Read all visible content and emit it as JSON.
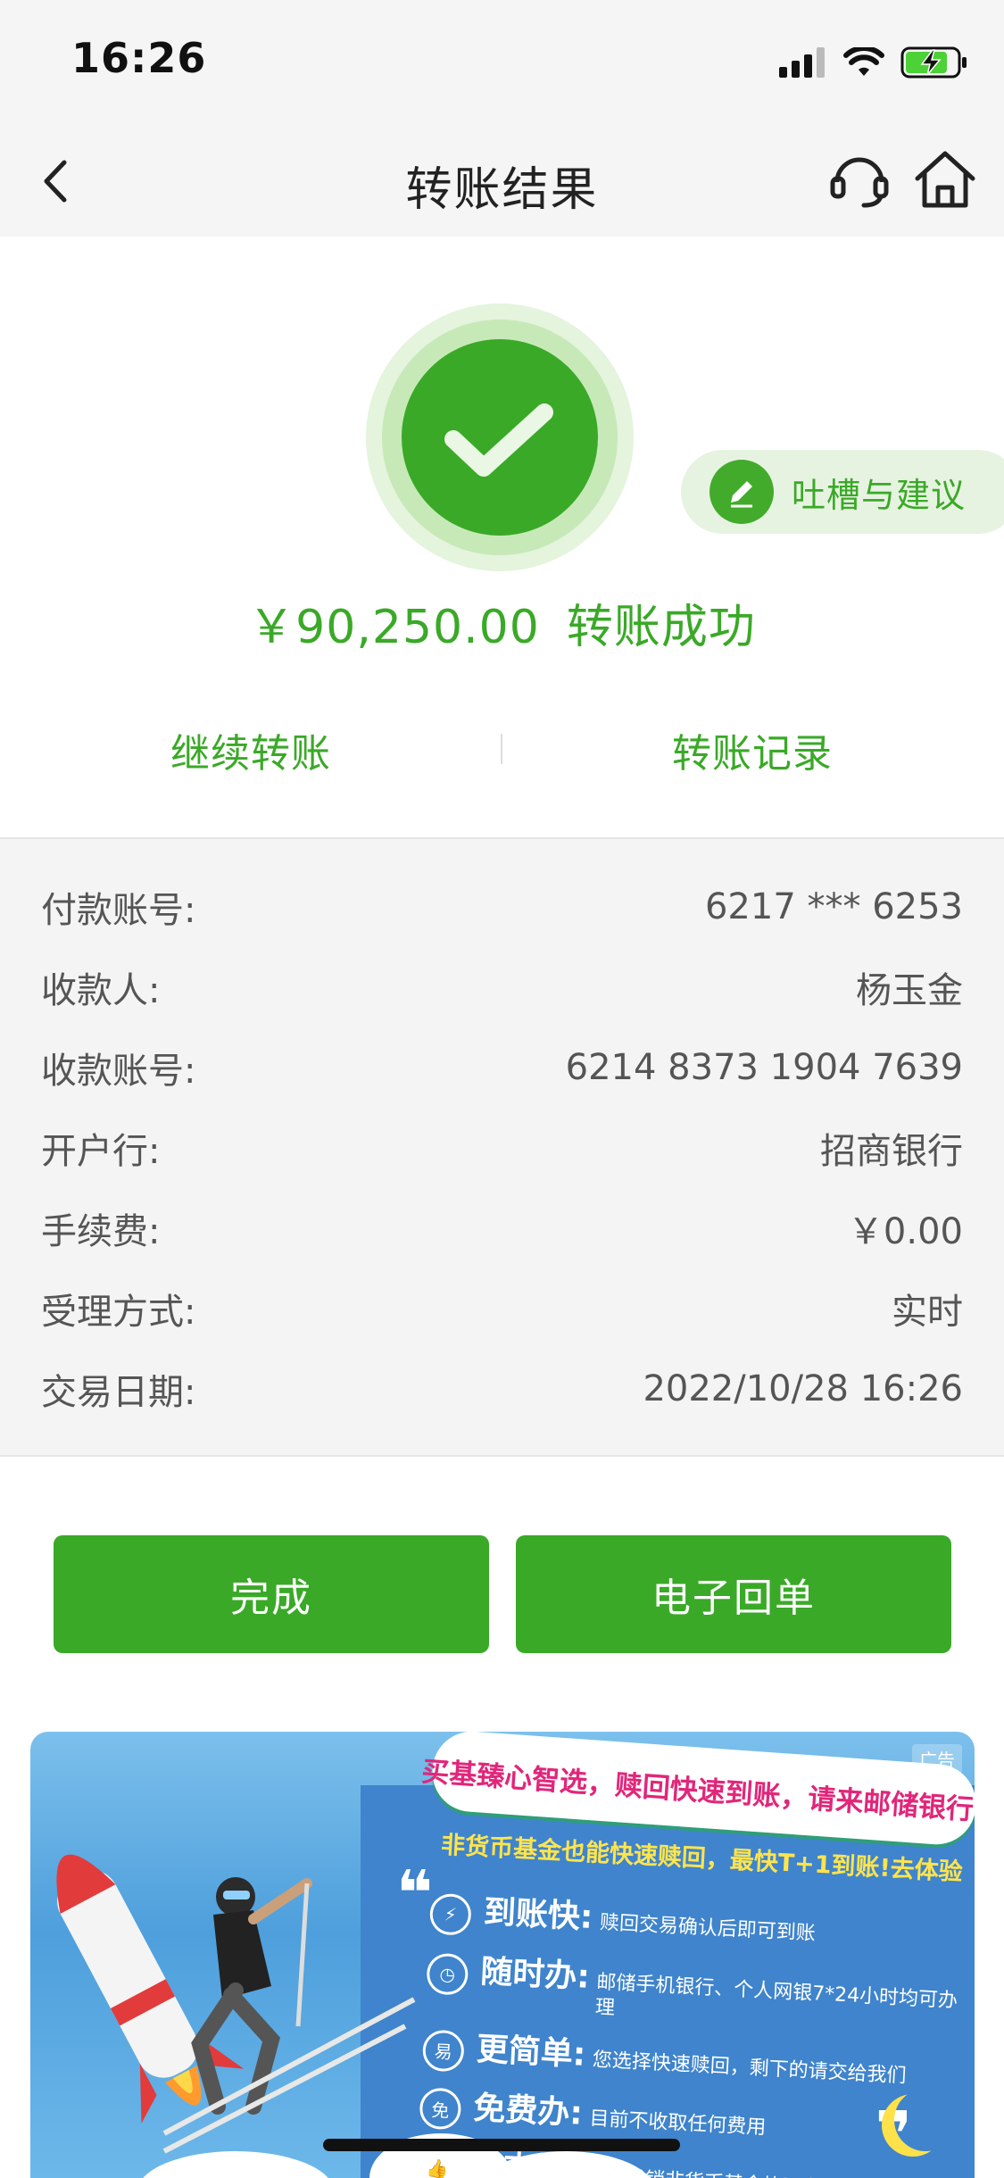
{
  "status_bar": {
    "time": "16:26",
    "icons": [
      "signal-icon",
      "wifi-icon",
      "battery-charging-icon"
    ]
  },
  "nav": {
    "title": "转账结果",
    "back_icon": "chevron-left-icon",
    "service_icon": "headset-icon",
    "home_icon": "home-icon"
  },
  "result": {
    "amount": "￥90,250.00",
    "status": "转账成功",
    "icon": "check-icon"
  },
  "feedback": {
    "label": "吐槽与建议",
    "icon": "pencil-icon"
  },
  "actions": {
    "continue_label": "继续转账",
    "records_label": "转账记录"
  },
  "details": [
    {
      "key": "付款账号:",
      "value": "6217 *** 6253"
    },
    {
      "key": "收款人:",
      "value": "杨玉金"
    },
    {
      "key": "收款账号:",
      "value": "6214 8373 1904 7639"
    },
    {
      "key": "开户行:",
      "value": "招商银行"
    },
    {
      "key": "手续费:",
      "value": "￥0.00"
    },
    {
      "key": "受理方式:",
      "value": "实时"
    },
    {
      "key": "交易日期:",
      "value": "2022/10/28 16:26"
    }
  ],
  "buttons": {
    "done_label": "完成",
    "receipt_label": "电子回单"
  },
  "ad": {
    "tag": "广告",
    "headline": "买基臻心智选，赎回快速到账，请来邮储银行!",
    "subline": "非货币基金也能快速赎回，最快T+1到账!去体验",
    "items": [
      {
        "head": "到账快:",
        "desc": "赎回交易确认后即可到账",
        "icon": "lightning-icon"
      },
      {
        "head": "随时办:",
        "desc": "邮储手机银行、个人网银7*24小时均可办理",
        "icon": "clock-icon"
      },
      {
        "head": "更简单:",
        "desc": "您选择快速赎回，剩下的请交给我们",
        "icon": "easy-icon"
      },
      {
        "head": "免费办:",
        "desc": "目前不收取任何费用",
        "icon": "free-icon"
      },
      {
        "head": "全支持:",
        "desc": "所有代销非货币基金均可办理",
        "icon": "thumbs-up-icon"
      }
    ],
    "badge_easy": "易",
    "badge_free": "免",
    "colors": {
      "accent": "#3aa927",
      "ad_headline": "#e1267a",
      "ad_sub": "#ffe44d"
    }
  }
}
